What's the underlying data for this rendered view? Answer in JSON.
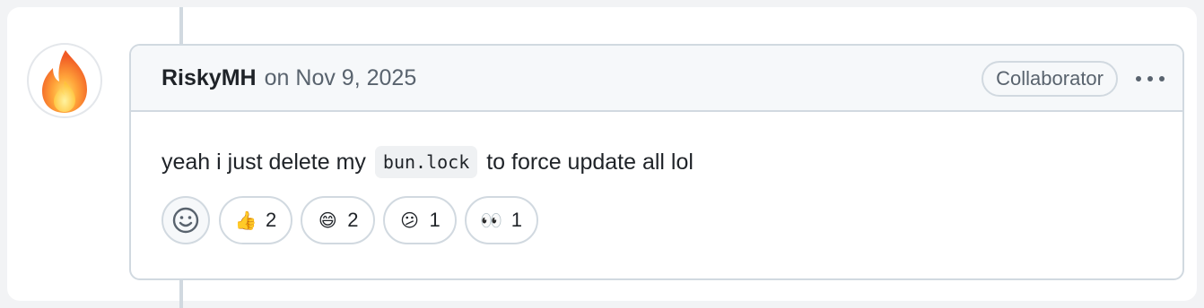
{
  "comment": {
    "author": "RiskyMH",
    "on_label": "on",
    "date": "Nov 9, 2025",
    "badge": "Collaborator",
    "body_before": "yeah i just delete my",
    "body_code": "bun.lock",
    "body_after": "to force update all lol"
  },
  "reactions": [
    {
      "icon": "thumbs-up-icon",
      "emoji": "👍",
      "count": "2"
    },
    {
      "icon": "grinning-face-icon",
      "emoji": "😄",
      "count": "2"
    },
    {
      "icon": "confused-face-icon",
      "emoji": "😕",
      "count": "1"
    },
    {
      "icon": "eyes-icon",
      "emoji": "👀",
      "count": "1"
    }
  ],
  "colors": {
    "border": "#d1d9e0",
    "header_bg": "#f6f8fa",
    "muted_text": "#59636e",
    "text": "#1f2328"
  }
}
